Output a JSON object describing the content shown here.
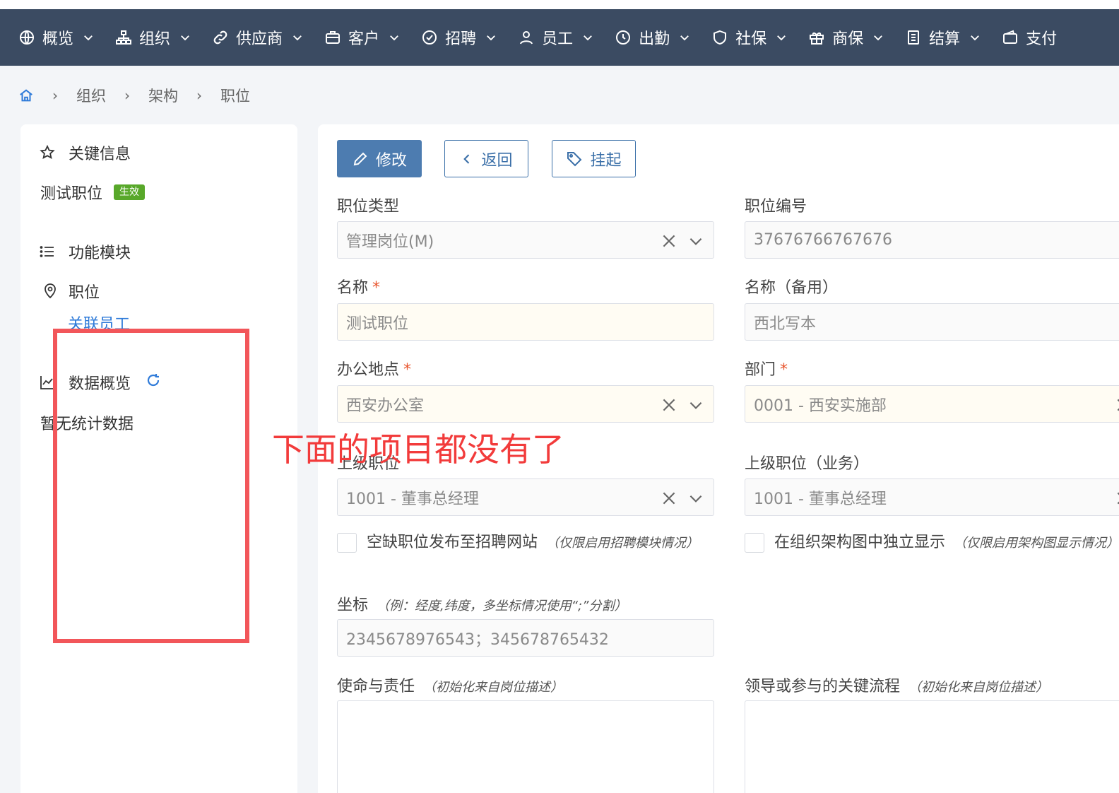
{
  "nav": [
    {
      "label": "概览",
      "icon": "globe-icon"
    },
    {
      "label": "组织",
      "icon": "org-chart-icon"
    },
    {
      "label": "供应商",
      "icon": "link-icon"
    },
    {
      "label": "客户",
      "icon": "briefcase-icon"
    },
    {
      "label": "招聘",
      "icon": "check-badge-icon"
    },
    {
      "label": "员工",
      "icon": "user-icon"
    },
    {
      "label": "出勤",
      "icon": "clock-icon"
    },
    {
      "label": "社保",
      "icon": "shield-icon"
    },
    {
      "label": "商保",
      "icon": "gift-icon"
    },
    {
      "label": "结算",
      "icon": "document-icon"
    },
    {
      "label": "支付",
      "icon": "wallet-icon"
    }
  ],
  "breadcrumb": [
    "组织",
    "架构",
    "职位"
  ],
  "sidebar": {
    "key_info_title": "关键信息",
    "position_name": "测试职位",
    "status_badge": "生效",
    "modules_title": "功能模块",
    "position_item": "职位",
    "related_employees": "关联员工",
    "data_overview_title": "数据概览",
    "no_stats": "暂无统计数据"
  },
  "toolbar": {
    "edit": "修改",
    "back": "返回",
    "suspend": "挂起"
  },
  "form": {
    "position_type": {
      "label": "职位类型",
      "value": "管理岗位(M)"
    },
    "position_code": {
      "label": "职位编号",
      "value": "37676766767676"
    },
    "name": {
      "label": "名称",
      "value": "测试职位"
    },
    "name_alt": {
      "label": "名称（备用）",
      "value": "西北写本"
    },
    "office": {
      "label": "办公地点",
      "value": "西安办公室"
    },
    "department": {
      "label": "部门",
      "value": "0001 - 西安实施部"
    },
    "parent_position": {
      "label": "上级职位",
      "value": "1001 - 董事总经理"
    },
    "parent_position_biz": {
      "label": "上级职位（业务）",
      "value": "1001 - 董事总经理"
    },
    "publish_vacancy": {
      "label": "空缺职位发布至招聘网站",
      "hint": "（仅限启用招聘模块情况）"
    },
    "show_in_chart": {
      "label": "在组织架构图中独立显示",
      "hint": "（仅限启用架构图显示情况）"
    },
    "coords": {
      "label": "坐标",
      "hint": "（例：经度,纬度，多坐标情况使用“;”分割）",
      "value": "2345678976543；345678765432"
    },
    "mission": {
      "label": "使命与责任",
      "hint": "（初始化来自岗位描述）"
    },
    "key_process": {
      "label": "领导或参与的关键流程",
      "hint": "（初始化来自岗位描述）"
    }
  },
  "annotation": "下面的项目都没有了",
  "colors": {
    "navbar": "#3b4b62",
    "primary": "#4d7cb0",
    "badge": "#58a82a",
    "annotation": "#f23b3b"
  }
}
